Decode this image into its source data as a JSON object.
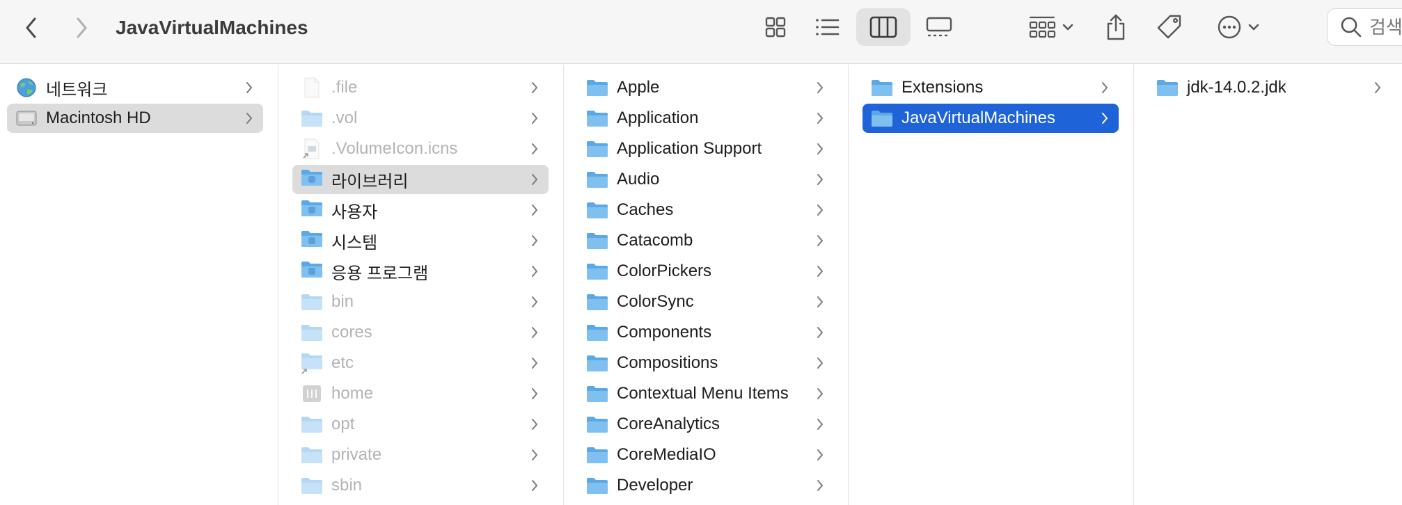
{
  "window": {
    "title": "JavaVirtualMachines",
    "search_placeholder": "검색"
  },
  "sidebar_column": {
    "items": [
      {
        "label": "네트워크",
        "icon": "globe-icon"
      },
      {
        "label": "Macintosh HD",
        "icon": "hard-drive-icon"
      }
    ]
  },
  "column1": {
    "items": [
      {
        "label": ".file",
        "icon": "document-icon"
      },
      {
        "label": ".vol",
        "icon": "folder-icon"
      },
      {
        "label": ".VolumeIcon.icns",
        "icon": "alias-document-icon"
      },
      {
        "label": "라이브러리",
        "icon": "library-folder-icon"
      },
      {
        "label": "사용자",
        "icon": "users-folder-icon"
      },
      {
        "label": "시스템",
        "icon": "system-folder-icon"
      },
      {
        "label": "응용 프로그램",
        "icon": "applications-folder-icon"
      },
      {
        "label": "bin",
        "icon": "folder-icon"
      },
      {
        "label": "cores",
        "icon": "folder-icon"
      },
      {
        "label": "etc",
        "icon": "alias-folder-icon"
      },
      {
        "label": "home",
        "icon": "network-volume-icon"
      },
      {
        "label": "opt",
        "icon": "folder-icon"
      },
      {
        "label": "private",
        "icon": "folder-icon"
      },
      {
        "label": "sbin",
        "icon": "folder-icon"
      }
    ]
  },
  "column2": {
    "items": [
      {
        "label": "Apple"
      },
      {
        "label": "Application"
      },
      {
        "label": "Application Support"
      },
      {
        "label": "Audio"
      },
      {
        "label": "Caches"
      },
      {
        "label": "Catacomb"
      },
      {
        "label": "ColorPickers"
      },
      {
        "label": "ColorSync"
      },
      {
        "label": "Components"
      },
      {
        "label": "Compositions"
      },
      {
        "label": "Contextual Menu Items"
      },
      {
        "label": "CoreAnalytics"
      },
      {
        "label": "CoreMediaIO"
      },
      {
        "label": "Developer"
      }
    ]
  },
  "column3": {
    "items": [
      {
        "label": "Extensions"
      },
      {
        "label": "JavaVirtualMachines"
      }
    ]
  },
  "column4": {
    "items": [
      {
        "label": "jdk-14.0.2.jdk"
      }
    ]
  },
  "colors": {
    "selection_blue": "#1f63d9",
    "selection_gray": "#dcdcdc",
    "folder_blue": "#5aa9e6"
  }
}
